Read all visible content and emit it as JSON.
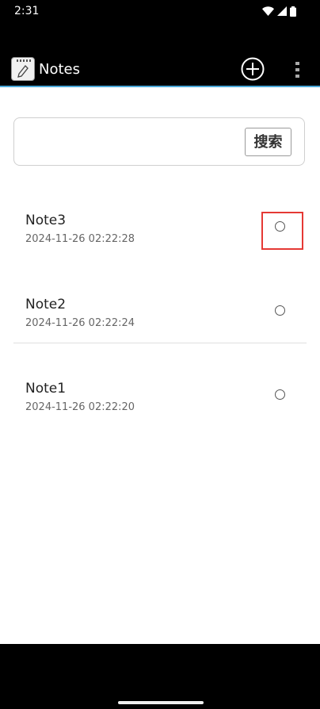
{
  "status_bar": {
    "time": "2:31"
  },
  "app_bar": {
    "title": "Notes",
    "logo_icon": "notepad-pencil-icon",
    "add_icon": "plus-circle-icon",
    "more_icon": "more-vertical-icon"
  },
  "search": {
    "value": "",
    "placeholder": "",
    "button_label": "搜索"
  },
  "notes": [
    {
      "title": "Note3",
      "timestamp": "2024-11-26 02:22:28",
      "selected": false
    },
    {
      "title": "Note2",
      "timestamp": "2024-11-26 02:22:24",
      "selected": false
    },
    {
      "title": "Note1",
      "timestamp": "2024-11-26 02:22:20",
      "selected": false
    }
  ],
  "colors": {
    "accent": "#4aa7d8",
    "highlight": "#e53935"
  }
}
